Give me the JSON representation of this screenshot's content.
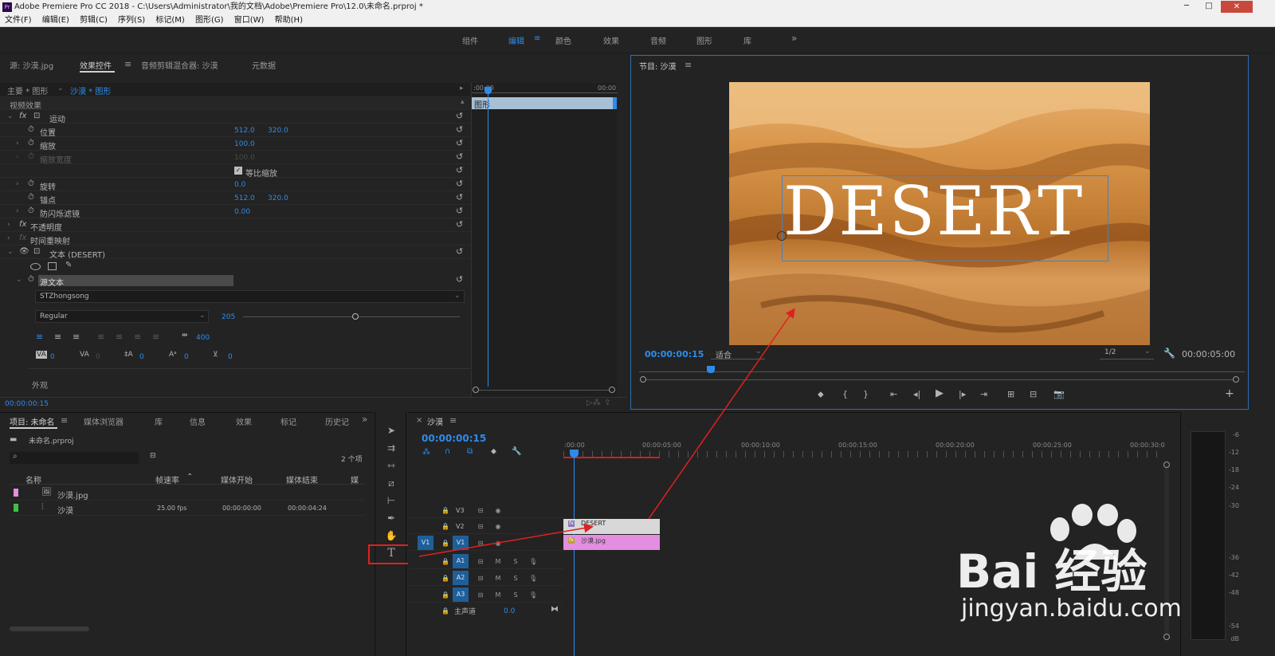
{
  "window": {
    "title": "Adobe Premiere Pro CC 2018 - C:\\Users\\Administrator\\我的文档\\Adobe\\Premiere Pro\\12.0\\未命名.prproj *"
  },
  "menu": [
    "文件(F)",
    "编辑(E)",
    "剪辑(C)",
    "序列(S)",
    "标记(M)",
    "图形(G)",
    "窗口(W)",
    "帮助(H)"
  ],
  "workspaces": [
    {
      "label": "组件",
      "active": false
    },
    {
      "label": "编辑",
      "active": true
    },
    {
      "label": "颜色",
      "active": false
    },
    {
      "label": "效果",
      "active": false
    },
    {
      "label": "音频",
      "active": false
    },
    {
      "label": "图形",
      "active": false
    },
    {
      "label": "库",
      "active": false
    }
  ],
  "workspace_more": "»",
  "source_tabs": [
    "源: 沙漠.jpg",
    "效果控件",
    "音频剪辑混合器: 沙漠",
    "元数据"
  ],
  "ec": {
    "master": "主要 * 图形",
    "clip": "沙漠 * 图形",
    "video_effects": "视频效果",
    "motion": "运动",
    "position": "位置",
    "pos_x": "512.0",
    "pos_y": "320.0",
    "scale": "缩放",
    "scale_val": "100.0",
    "scale_width": "缩放宽度",
    "scale_width_val": "100.0",
    "uniform": "等比缩放",
    "rotation": "旋转",
    "rotation_val": "0.0",
    "anchor": "锚点",
    "anchor_x": "512.0",
    "anchor_y": "320.0",
    "flicker": "防闪烁滤镜",
    "flicker_val": "0.00",
    "opacity": "不透明度",
    "time_remap": "时间重映射",
    "text": "文本 (DESERT)",
    "source_text": "源文本",
    "font": "STZhongsong",
    "style": "Regular",
    "size": "205",
    "tracking": "400",
    "kern_val": "0",
    "lead_val": "0",
    "baseline_val": "0",
    "tsume_val": "0",
    "appearance": "外观",
    "timecode": "00:00:00:15",
    "mini_start": ":00:00",
    "mini_end": "00:00",
    "mini_clip": "图形"
  },
  "program": {
    "title": "节目: 沙漠",
    "overlay_text": "DESERT",
    "timecode": "00:00:00:15",
    "fit": "适合",
    "resolution": "1/2",
    "duration": "00:00:05:00"
  },
  "project": {
    "tabs": [
      "项目: 未命名",
      "媒体浏览器",
      "库",
      "信息",
      "效果",
      "标记",
      "历史记"
    ],
    "file": "未命名.prproj",
    "count": "2 个项",
    "columns": [
      "名称",
      "帧速率",
      "媒体开始",
      "媒体结束",
      "媒"
    ],
    "items": [
      {
        "name": "沙漠.jpg",
        "fps": "",
        "start": "",
        "end": "",
        "color": "#e38ee0"
      },
      {
        "name": "沙漠",
        "fps": "25.00 fps",
        "start": "00:00:00:00",
        "end": "00:00:04:24",
        "color": "#3fc044"
      }
    ]
  },
  "timeline": {
    "name": "沙漠",
    "timecode": "00:00:00:15",
    "ruler": [
      ":00:00",
      "00:00:05:00",
      "00:00:10:00",
      "00:00:15:00",
      "00:00:20:00",
      "00:00:25:00",
      "00:00:30:0"
    ],
    "video_tracks": [
      "V3",
      "V2",
      "V1"
    ],
    "audio_tracks": [
      "A1",
      "A2",
      "A3"
    ],
    "source_v": "V1",
    "mix": "主声道",
    "mix_val": "0.0",
    "clip_graphic": "DESERT",
    "clip_image": "沙漠.jpg",
    "m": "M",
    "s": "S"
  },
  "meter": {
    "db": [
      "-6",
      "-12",
      "-18",
      "-24",
      "-30",
      "-36",
      "-42",
      "-48",
      "-54",
      "dB"
    ]
  },
  "watermark": {
    "brand": "Bai 经验",
    "url": "jingyan.baidu.com"
  },
  "colors": {
    "accent": "#2d8ceb",
    "annotation": "#e02020",
    "graphic_clip": "#d8d8d8",
    "image_clip": "#e38ee0"
  }
}
